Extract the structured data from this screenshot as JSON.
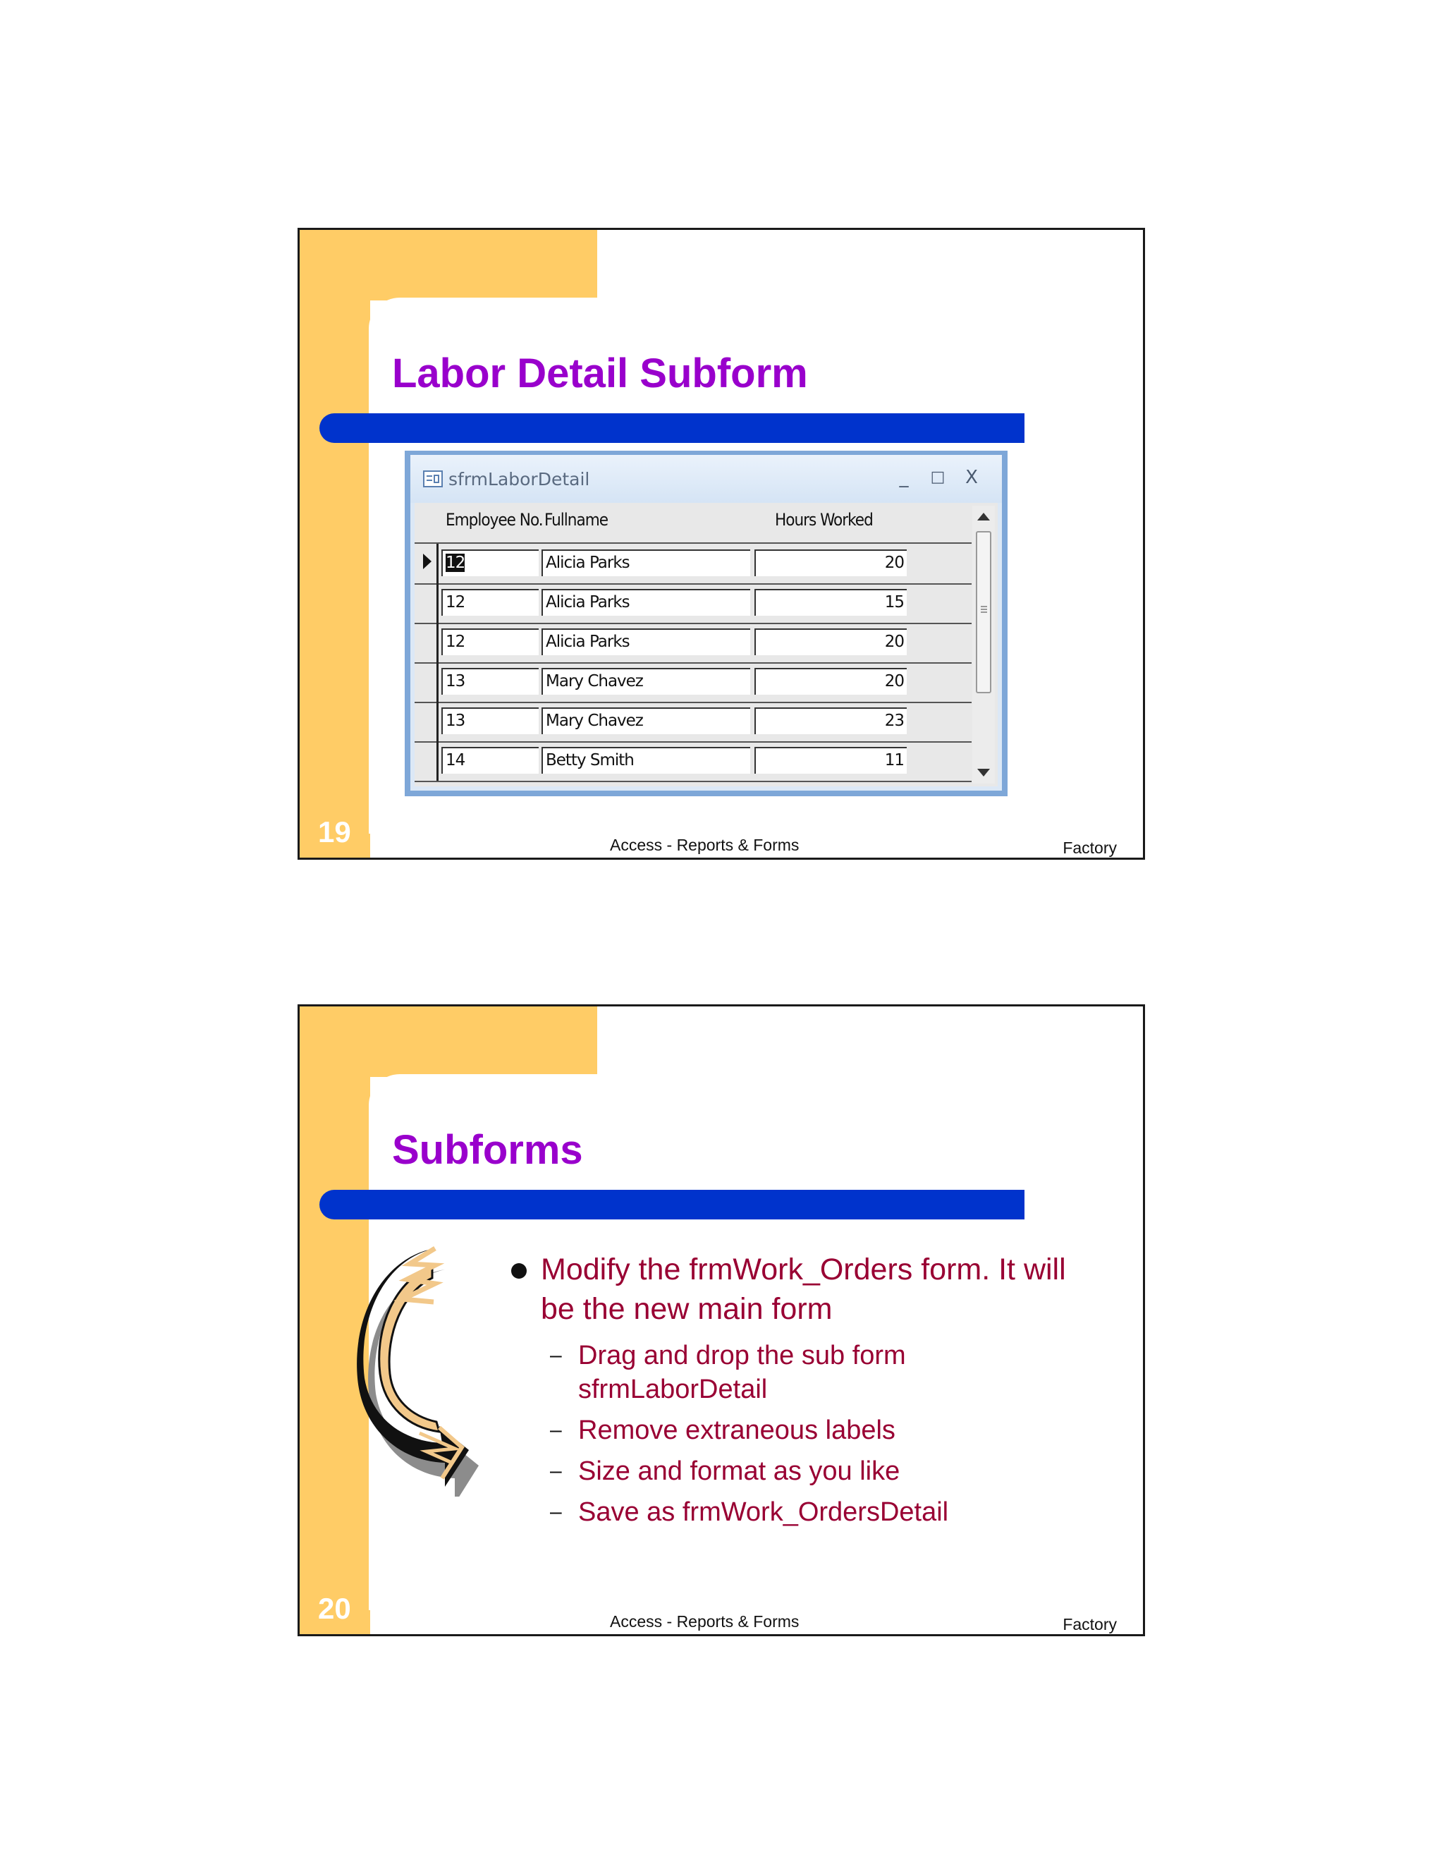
{
  "slides": [
    {
      "number": "19",
      "title": "Labor Detail Subform",
      "footer_center": "Access - Reports & Forms",
      "footer_right": "Factory",
      "window": {
        "title": "sfrmLaborDetail",
        "buttons": {
          "minimize": "_",
          "maximize": "□",
          "close": "X"
        },
        "columns": [
          "Employee No.",
          "Fullname",
          "Hours Worked"
        ],
        "rows": [
          {
            "employee_no": "12",
            "fullname": "Alicia Parks",
            "hours": "20"
          },
          {
            "employee_no": "12",
            "fullname": "Alicia Parks",
            "hours": "15"
          },
          {
            "employee_no": "12",
            "fullname": "Alicia Parks",
            "hours": "20"
          },
          {
            "employee_no": "13",
            "fullname": "Mary Chavez",
            "hours": "20"
          },
          {
            "employee_no": "13",
            "fullname": "Mary Chavez",
            "hours": "23"
          },
          {
            "employee_no": "14",
            "fullname": "Betty Smith",
            "hours": "11"
          }
        ]
      }
    },
    {
      "number": "20",
      "title": "Subforms",
      "footer_center": "Access - Reports & Forms",
      "footer_right": "Factory",
      "bullet": "Modify the frmWork_Orders form. It will be the new main form",
      "sub_bullets": [
        "Drag and drop the sub form sfrmLaborDetail",
        "Remove extraneous labels",
        "Size and format as you like",
        "Save as frmWork_OrdersDetail"
      ]
    }
  ],
  "colors": {
    "accent_yellow": "#ffcc66",
    "title_purple": "#9900cc",
    "bar_blue": "#0033cc",
    "bullet_red": "#990033"
  }
}
